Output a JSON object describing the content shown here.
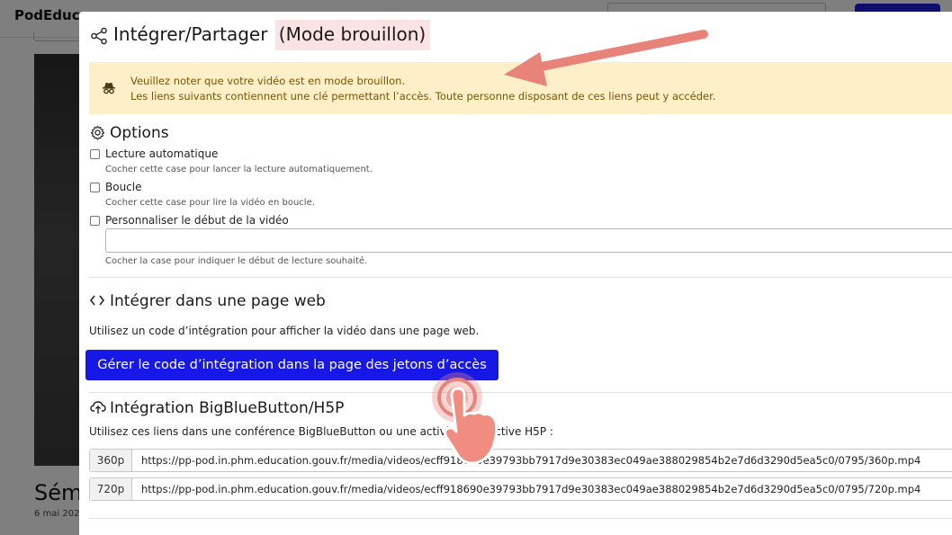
{
  "background": {
    "brand": "PodEduc",
    "video_title": "Sém",
    "video_date": "6 mai 202"
  },
  "modal": {
    "title": "Intégrer/Partager",
    "draft_label": "(Mode brouillon)",
    "share_icon": "share-icon",
    "alert": {
      "icon": "incognito-icon",
      "line1": "Veuillez noter que votre vidéo est en mode brouillon.",
      "line2": "Les liens suivants contiennent une clé permettant l’accès. Toute personne disposant de ces liens peut y accéder."
    },
    "options": {
      "title": "Options",
      "items": [
        {
          "label": "Lecture automatique",
          "help": "Cocher cette case pour lancer la lecture automatiquement.",
          "checked": false
        },
        {
          "label": "Boucle",
          "help": "Cocher cette case pour lire la vidéo en boucle.",
          "checked": false
        },
        {
          "label": "Personnaliser le début de la vidéo",
          "help": "Cocher la case pour indiquer le début de lecture souhaité.",
          "checked": false
        }
      ],
      "start_value": ""
    },
    "embed": {
      "title": "Intégrer dans une page web",
      "description": "Utilisez un code d’intégration pour afficher la vidéo dans une page web.",
      "button_label": "Gérer le code d’intégration dans la page des jetons d’accès"
    },
    "bbb": {
      "title": "Intégration BigBlueButton/H5P",
      "description": "Utilisez ces liens dans une conférence BigBlueButton ou une activité interactive H5P :",
      "links": [
        {
          "quality": "360p",
          "url": "https://pp-pod.in.phm.education.gouv.fr/media/videos/ecff918690e39793bb7917d9e30383ec049ae388029854b2e7d6d3290d5ea5c0/0795/360p.mp4"
        },
        {
          "quality": "720p",
          "url": "https://pp-pod.in.phm.education.gouv.fr/media/videos/ecff918690e39793bb7917d9e30383ec049ae388029854b2e7d6d3290d5ea5c0/0795/720p.mp4"
        }
      ]
    }
  },
  "colors": {
    "accent": "#1717e8",
    "alert_bg": "#fdefc7",
    "alert_text": "#7b5400",
    "draft_bg": "#fbe3e3",
    "annotation": "#e8837a"
  }
}
